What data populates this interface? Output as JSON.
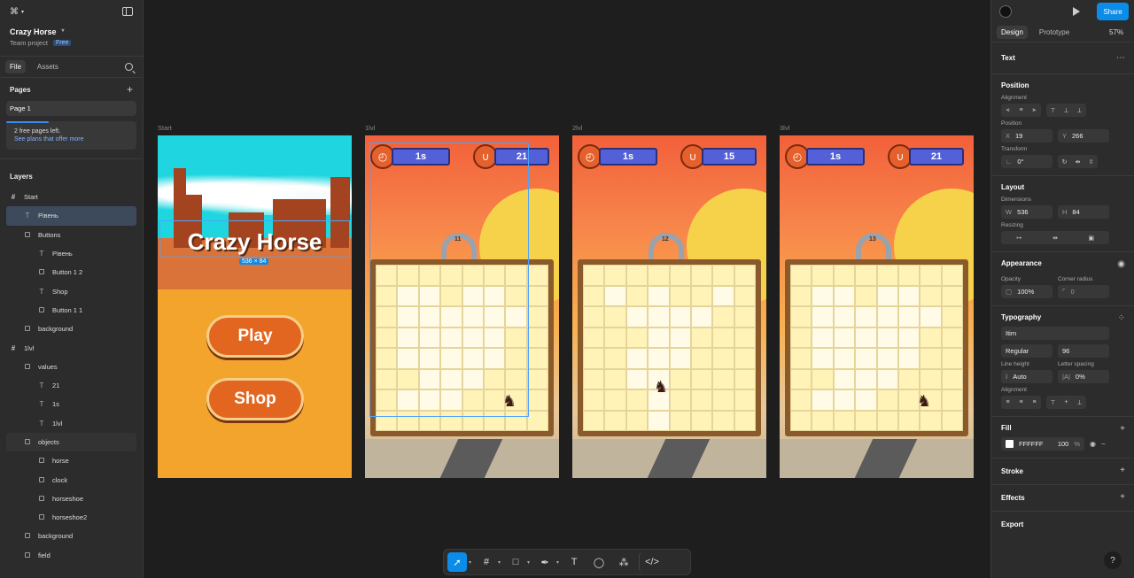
{
  "project": {
    "name": "Crazy Horse",
    "team": "Team project",
    "plan": "Free"
  },
  "left_tabs": [
    "File",
    "Assets"
  ],
  "pages": {
    "header": "Pages",
    "items": [
      "Page 1"
    ],
    "notice": "2 free pages left.",
    "notice_link": "See plans that offer more"
  },
  "layers": {
    "header": "Layers",
    "items": [
      {
        "label": "Start",
        "icon": "#",
        "indent": 0,
        "state": ""
      },
      {
        "label": "Рівень",
        "icon": "T",
        "indent": 1,
        "state": "selected"
      },
      {
        "label": "Buttons",
        "icon": "box",
        "indent": 1,
        "state": ""
      },
      {
        "label": "Рівень",
        "icon": "T",
        "indent": 2,
        "state": ""
      },
      {
        "label": "Button 1 2",
        "icon": "img",
        "indent": 2,
        "state": ""
      },
      {
        "label": "Shop",
        "icon": "T",
        "indent": 2,
        "state": ""
      },
      {
        "label": "Button 1 1",
        "icon": "img",
        "indent": 2,
        "state": ""
      },
      {
        "label": "background",
        "icon": "img",
        "indent": 1,
        "state": ""
      },
      {
        "label": "1lvl",
        "icon": "#",
        "indent": 0,
        "state": ""
      },
      {
        "label": "values",
        "icon": "box",
        "indent": 1,
        "state": ""
      },
      {
        "label": "21",
        "icon": "T",
        "indent": 2,
        "state": ""
      },
      {
        "label": "1s",
        "icon": "T",
        "indent": 2,
        "state": ""
      },
      {
        "label": "1lvl",
        "icon": "T",
        "indent": 2,
        "state": ""
      },
      {
        "label": "objects",
        "icon": "box",
        "indent": 1,
        "state": "hover"
      },
      {
        "label": "horse",
        "icon": "img",
        "indent": 2,
        "state": ""
      },
      {
        "label": "clock",
        "icon": "img",
        "indent": 2,
        "state": ""
      },
      {
        "label": "horseshoe",
        "icon": "img",
        "indent": 2,
        "state": ""
      },
      {
        "label": "horseshoe2",
        "icon": "img",
        "indent": 2,
        "state": ""
      },
      {
        "label": "background",
        "icon": "img",
        "indent": 1,
        "state": ""
      },
      {
        "label": "field",
        "icon": "img",
        "indent": 1,
        "state": ""
      }
    ]
  },
  "right": {
    "share": "Share",
    "tabs": [
      "Design",
      "Prototype"
    ],
    "zoom": "57%",
    "section_title": "Text",
    "position": {
      "header": "Position",
      "alignment": "Alignment",
      "position_label": "Position",
      "x_key": "X",
      "x": "19",
      "y_key": "Y",
      "y": "266",
      "transform": "Transform",
      "rotation": "0°"
    },
    "layout": {
      "header": "Layout",
      "dimensions": "Dimensions",
      "w_key": "W",
      "w": "536",
      "h_key": "H",
      "h": "84",
      "resizing": "Resizing"
    },
    "appearance": {
      "header": "Appearance",
      "opacity_label": "Opacity",
      "opacity": "100%",
      "radius_label": "Corner radius",
      "radius": "0"
    },
    "typography": {
      "header": "Typography",
      "font": "Itim",
      "weight": "Regular",
      "size": "96",
      "line_height_label": "Line height",
      "line_height": "Auto",
      "letter_spacing_label": "Letter spacing",
      "letter_spacing": "0%",
      "alignment": "Alignment"
    },
    "fill": {
      "header": "Fill",
      "color": "FFFFFF",
      "opacity": "100",
      "pct": "%"
    },
    "stroke": "Stroke",
    "effects": "Effects",
    "export": "Export"
  },
  "canvas": {
    "frames": [
      {
        "label": "Start"
      },
      {
        "label": "1lvl",
        "time": "1s",
        "moves": "21",
        "shoe_num": "11"
      },
      {
        "label": "2lvl",
        "time": "1s",
        "moves": "15",
        "shoe_num": "12"
      },
      {
        "label": "3lvl",
        "time": "1s",
        "moves": "21",
        "shoe_num": "13"
      }
    ],
    "start_title": "Crazy Horse",
    "dim_badge": "536 × 84",
    "play": "Play",
    "shop": "Shop"
  },
  "colors": {
    "accent": "#0c8ce9",
    "panel": "#2c2c2c",
    "canvas": "#1e1e1e"
  }
}
